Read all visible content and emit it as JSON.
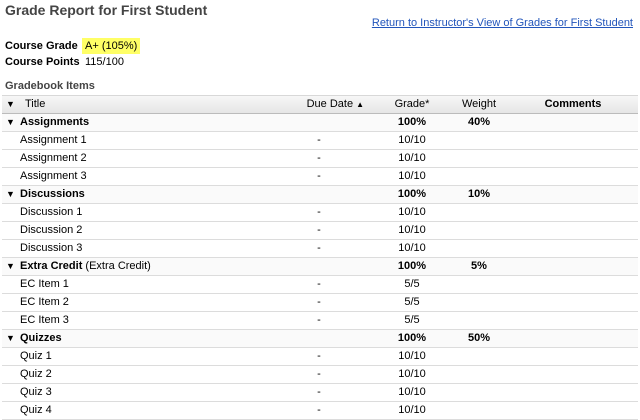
{
  "page": {
    "title": "Grade Report for First Student",
    "return_link": "Return to Instructor's View of Grades for First Student"
  },
  "summary": {
    "course_grade_label": "Course Grade",
    "course_grade_value": "A+ (105%)",
    "course_points_label": "Course Points",
    "course_points_value": "115/100"
  },
  "gradebook": {
    "heading": "Gradebook Items",
    "columns": {
      "title": "Title",
      "due_date": "Due Date",
      "grade": "Grade*",
      "weight": "Weight",
      "comments": "Comments"
    },
    "categories": [
      {
        "name": "Assignments",
        "note": "",
        "grade": "100%",
        "weight": "40%",
        "items": [
          {
            "title": "Assignment 1",
            "due": "-",
            "grade": "10/10"
          },
          {
            "title": "Assignment 2",
            "due": "-",
            "grade": "10/10"
          },
          {
            "title": "Assignment 3",
            "due": "-",
            "grade": "10/10"
          }
        ]
      },
      {
        "name": "Discussions",
        "note": "",
        "grade": "100%",
        "weight": "10%",
        "items": [
          {
            "title": "Discussion 1",
            "due": "-",
            "grade": "10/10"
          },
          {
            "title": "Discussion 2",
            "due": "-",
            "grade": "10/10"
          },
          {
            "title": "Discussion 3",
            "due": "-",
            "grade": "10/10"
          }
        ]
      },
      {
        "name": "Extra Credit",
        "note": "(Extra Credit)",
        "grade": "100%",
        "weight": "5%",
        "items": [
          {
            "title": "EC Item 1",
            "due": "-",
            "grade": "5/5"
          },
          {
            "title": "EC Item 2",
            "due": "-",
            "grade": "5/5"
          },
          {
            "title": "EC Item 3",
            "due": "-",
            "grade": "5/5"
          }
        ]
      },
      {
        "name": "Quizzes",
        "note": "",
        "grade": "100%",
        "weight": "50%",
        "items": [
          {
            "title": "Quiz 1",
            "due": "-",
            "grade": "10/10"
          },
          {
            "title": "Quiz 2",
            "due": "-",
            "grade": "10/10"
          },
          {
            "title": "Quiz 3",
            "due": "-",
            "grade": "10/10"
          },
          {
            "title": "Quiz 4",
            "due": "-",
            "grade": "10/10"
          }
        ]
      }
    ]
  },
  "colors": {
    "highlight": "#ffff66",
    "link": "#2255bb"
  },
  "icons": {
    "collapse": "triangle-down-icon",
    "sort": "sort-ascending-icon"
  }
}
